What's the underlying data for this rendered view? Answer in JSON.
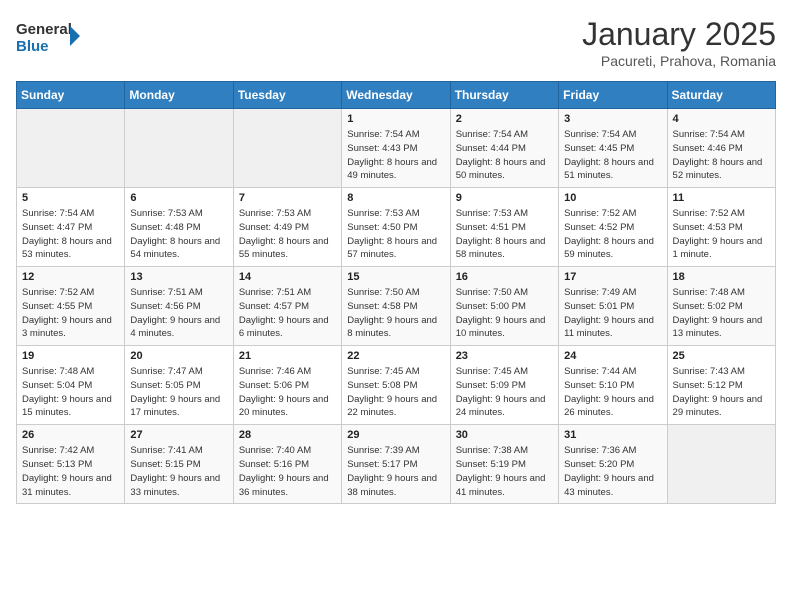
{
  "header": {
    "logo_general": "General",
    "logo_blue": "Blue",
    "month_title": "January 2025",
    "location": "Pacureti, Prahova, Romania"
  },
  "weekdays": [
    "Sunday",
    "Monday",
    "Tuesday",
    "Wednesday",
    "Thursday",
    "Friday",
    "Saturday"
  ],
  "weeks": [
    [
      {
        "day": "",
        "sunrise": "",
        "sunset": "",
        "daylight": ""
      },
      {
        "day": "",
        "sunrise": "",
        "sunset": "",
        "daylight": ""
      },
      {
        "day": "",
        "sunrise": "",
        "sunset": "",
        "daylight": ""
      },
      {
        "day": "1",
        "sunrise": "Sunrise: 7:54 AM",
        "sunset": "Sunset: 4:43 PM",
        "daylight": "Daylight: 8 hours and 49 minutes."
      },
      {
        "day": "2",
        "sunrise": "Sunrise: 7:54 AM",
        "sunset": "Sunset: 4:44 PM",
        "daylight": "Daylight: 8 hours and 50 minutes."
      },
      {
        "day": "3",
        "sunrise": "Sunrise: 7:54 AM",
        "sunset": "Sunset: 4:45 PM",
        "daylight": "Daylight: 8 hours and 51 minutes."
      },
      {
        "day": "4",
        "sunrise": "Sunrise: 7:54 AM",
        "sunset": "Sunset: 4:46 PM",
        "daylight": "Daylight: 8 hours and 52 minutes."
      }
    ],
    [
      {
        "day": "5",
        "sunrise": "Sunrise: 7:54 AM",
        "sunset": "Sunset: 4:47 PM",
        "daylight": "Daylight: 8 hours and 53 minutes."
      },
      {
        "day": "6",
        "sunrise": "Sunrise: 7:53 AM",
        "sunset": "Sunset: 4:48 PM",
        "daylight": "Daylight: 8 hours and 54 minutes."
      },
      {
        "day": "7",
        "sunrise": "Sunrise: 7:53 AM",
        "sunset": "Sunset: 4:49 PM",
        "daylight": "Daylight: 8 hours and 55 minutes."
      },
      {
        "day": "8",
        "sunrise": "Sunrise: 7:53 AM",
        "sunset": "Sunset: 4:50 PM",
        "daylight": "Daylight: 8 hours and 57 minutes."
      },
      {
        "day": "9",
        "sunrise": "Sunrise: 7:53 AM",
        "sunset": "Sunset: 4:51 PM",
        "daylight": "Daylight: 8 hours and 58 minutes."
      },
      {
        "day": "10",
        "sunrise": "Sunrise: 7:52 AM",
        "sunset": "Sunset: 4:52 PM",
        "daylight": "Daylight: 8 hours and 59 minutes."
      },
      {
        "day": "11",
        "sunrise": "Sunrise: 7:52 AM",
        "sunset": "Sunset: 4:53 PM",
        "daylight": "Daylight: 9 hours and 1 minute."
      }
    ],
    [
      {
        "day": "12",
        "sunrise": "Sunrise: 7:52 AM",
        "sunset": "Sunset: 4:55 PM",
        "daylight": "Daylight: 9 hours and 3 minutes."
      },
      {
        "day": "13",
        "sunrise": "Sunrise: 7:51 AM",
        "sunset": "Sunset: 4:56 PM",
        "daylight": "Daylight: 9 hours and 4 minutes."
      },
      {
        "day": "14",
        "sunrise": "Sunrise: 7:51 AM",
        "sunset": "Sunset: 4:57 PM",
        "daylight": "Daylight: 9 hours and 6 minutes."
      },
      {
        "day": "15",
        "sunrise": "Sunrise: 7:50 AM",
        "sunset": "Sunset: 4:58 PM",
        "daylight": "Daylight: 9 hours and 8 minutes."
      },
      {
        "day": "16",
        "sunrise": "Sunrise: 7:50 AM",
        "sunset": "Sunset: 5:00 PM",
        "daylight": "Daylight: 9 hours and 10 minutes."
      },
      {
        "day": "17",
        "sunrise": "Sunrise: 7:49 AM",
        "sunset": "Sunset: 5:01 PM",
        "daylight": "Daylight: 9 hours and 11 minutes."
      },
      {
        "day": "18",
        "sunrise": "Sunrise: 7:48 AM",
        "sunset": "Sunset: 5:02 PM",
        "daylight": "Daylight: 9 hours and 13 minutes."
      }
    ],
    [
      {
        "day": "19",
        "sunrise": "Sunrise: 7:48 AM",
        "sunset": "Sunset: 5:04 PM",
        "daylight": "Daylight: 9 hours and 15 minutes."
      },
      {
        "day": "20",
        "sunrise": "Sunrise: 7:47 AM",
        "sunset": "Sunset: 5:05 PM",
        "daylight": "Daylight: 9 hours and 17 minutes."
      },
      {
        "day": "21",
        "sunrise": "Sunrise: 7:46 AM",
        "sunset": "Sunset: 5:06 PM",
        "daylight": "Daylight: 9 hours and 20 minutes."
      },
      {
        "day": "22",
        "sunrise": "Sunrise: 7:45 AM",
        "sunset": "Sunset: 5:08 PM",
        "daylight": "Daylight: 9 hours and 22 minutes."
      },
      {
        "day": "23",
        "sunrise": "Sunrise: 7:45 AM",
        "sunset": "Sunset: 5:09 PM",
        "daylight": "Daylight: 9 hours and 24 minutes."
      },
      {
        "day": "24",
        "sunrise": "Sunrise: 7:44 AM",
        "sunset": "Sunset: 5:10 PM",
        "daylight": "Daylight: 9 hours and 26 minutes."
      },
      {
        "day": "25",
        "sunrise": "Sunrise: 7:43 AM",
        "sunset": "Sunset: 5:12 PM",
        "daylight": "Daylight: 9 hours and 29 minutes."
      }
    ],
    [
      {
        "day": "26",
        "sunrise": "Sunrise: 7:42 AM",
        "sunset": "Sunset: 5:13 PM",
        "daylight": "Daylight: 9 hours and 31 minutes."
      },
      {
        "day": "27",
        "sunrise": "Sunrise: 7:41 AM",
        "sunset": "Sunset: 5:15 PM",
        "daylight": "Daylight: 9 hours and 33 minutes."
      },
      {
        "day": "28",
        "sunrise": "Sunrise: 7:40 AM",
        "sunset": "Sunset: 5:16 PM",
        "daylight": "Daylight: 9 hours and 36 minutes."
      },
      {
        "day": "29",
        "sunrise": "Sunrise: 7:39 AM",
        "sunset": "Sunset: 5:17 PM",
        "daylight": "Daylight: 9 hours and 38 minutes."
      },
      {
        "day": "30",
        "sunrise": "Sunrise: 7:38 AM",
        "sunset": "Sunset: 5:19 PM",
        "daylight": "Daylight: 9 hours and 41 minutes."
      },
      {
        "day": "31",
        "sunrise": "Sunrise: 7:36 AM",
        "sunset": "Sunset: 5:20 PM",
        "daylight": "Daylight: 9 hours and 43 minutes."
      },
      {
        "day": "",
        "sunrise": "",
        "sunset": "",
        "daylight": ""
      }
    ]
  ]
}
